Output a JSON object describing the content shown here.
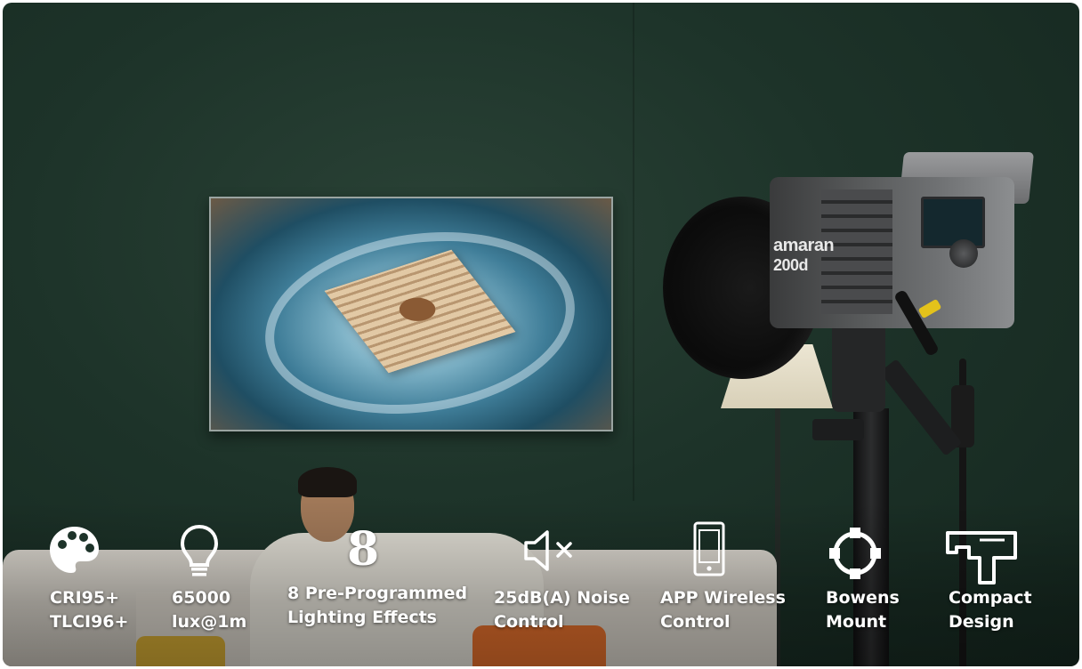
{
  "product": {
    "brand": "amaran",
    "model": "200d"
  },
  "features": [
    {
      "icon": "palette-icon",
      "line1": "CRI95+",
      "line2": "TLCI96+"
    },
    {
      "icon": "light-bulb-icon",
      "line1": "65000",
      "line2": "lux@1m"
    },
    {
      "icon": "number-eight-icon",
      "icon_text": "8",
      "line1": "8 Pre-Programmed",
      "line2": "Lighting Effects"
    },
    {
      "icon": "speaker-muted-icon",
      "line1": "25dB(A) Noise",
      "line2": "Control"
    },
    {
      "icon": "smartphone-icon",
      "line1": "APP Wireless",
      "line2": "Control"
    },
    {
      "icon": "bowens-mount-icon",
      "line1": "Bowens",
      "line2": "Mount"
    },
    {
      "icon": "compact-light-icon",
      "line1": "Compact",
      "line2": "Design"
    }
  ],
  "colors": {
    "wall": "#1d3329",
    "text": "#ffffff",
    "cable_ring": "#e3c21b"
  }
}
